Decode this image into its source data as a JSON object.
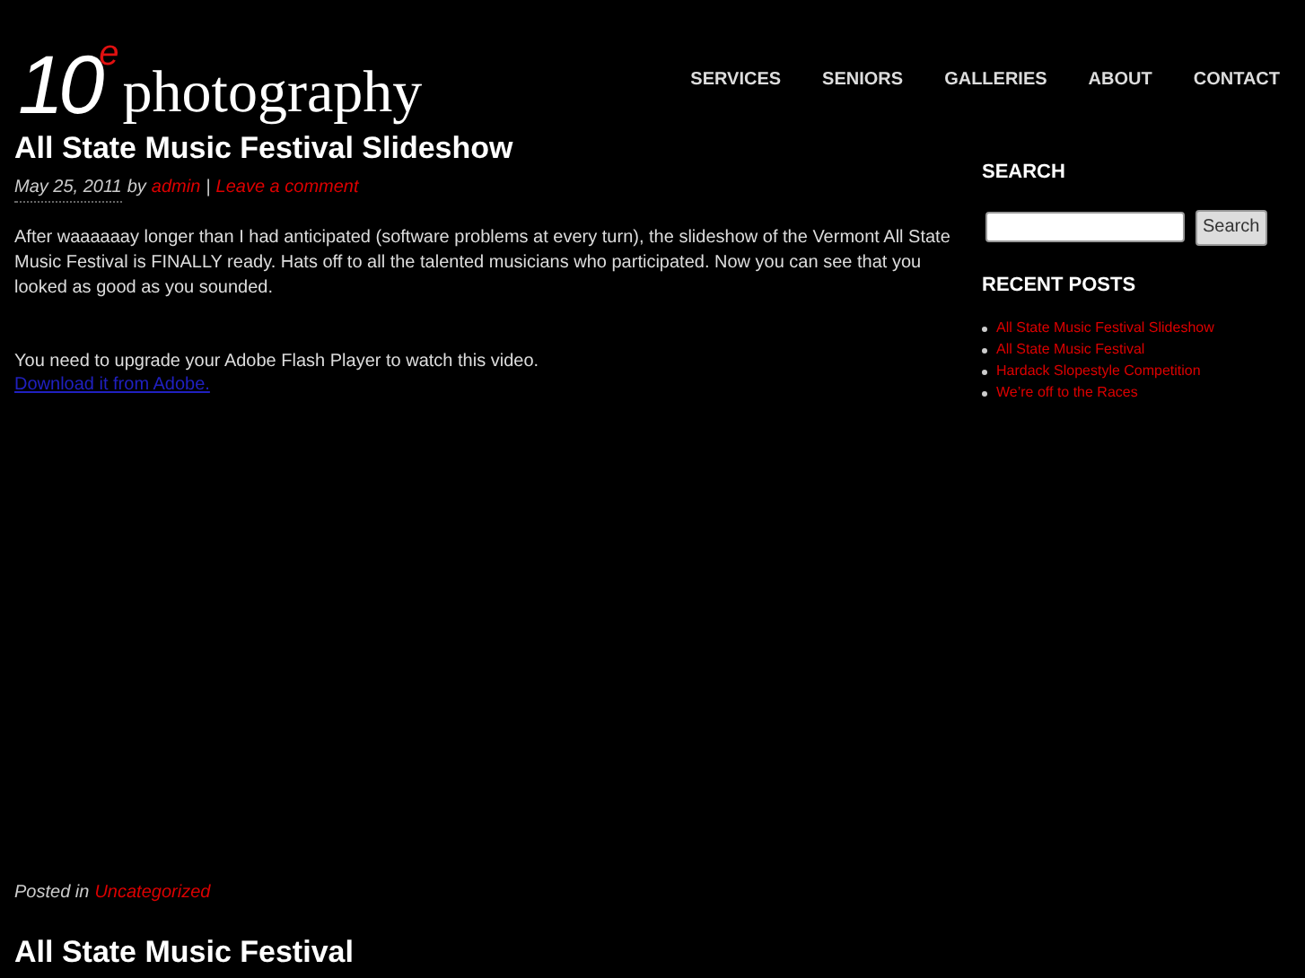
{
  "logo": {
    "number": "10",
    "superscript": "e",
    "word": "photography"
  },
  "nav": [
    "SERVICES",
    "SENIORS",
    "GALLERIES",
    "ABOUT",
    "CONTACT"
  ],
  "post": {
    "title": "All State Music Festival Slideshow",
    "date": "May 25, 2011",
    "by": "by",
    "author": "admin",
    "separator": "|",
    "comment_link": "Leave a comment",
    "body": "After waaaaaay longer than I had anticipated (software problems at every turn), the slideshow of the Vermont All State Music Festival is FINALLY ready. Hats off to all the talented musicians who participated. Now you can see that you looked as good as you sounded.",
    "flash_notice": "You need to upgrade your Adobe Flash Player to watch this video.",
    "flash_link": "Download it from Adobe.",
    "posted_in": "Posted in",
    "category": "Uncategorized"
  },
  "next_post": {
    "title": "All State Music Festival"
  },
  "sidebar": {
    "search_heading": "SEARCH",
    "search_button": "Search",
    "recent_heading": "RECENT POSTS",
    "recent_posts": [
      "All State Music Festival Slideshow",
      "All State Music Festival",
      "Hardack Slopestyle Competition",
      "We’re off to the Races"
    ]
  }
}
